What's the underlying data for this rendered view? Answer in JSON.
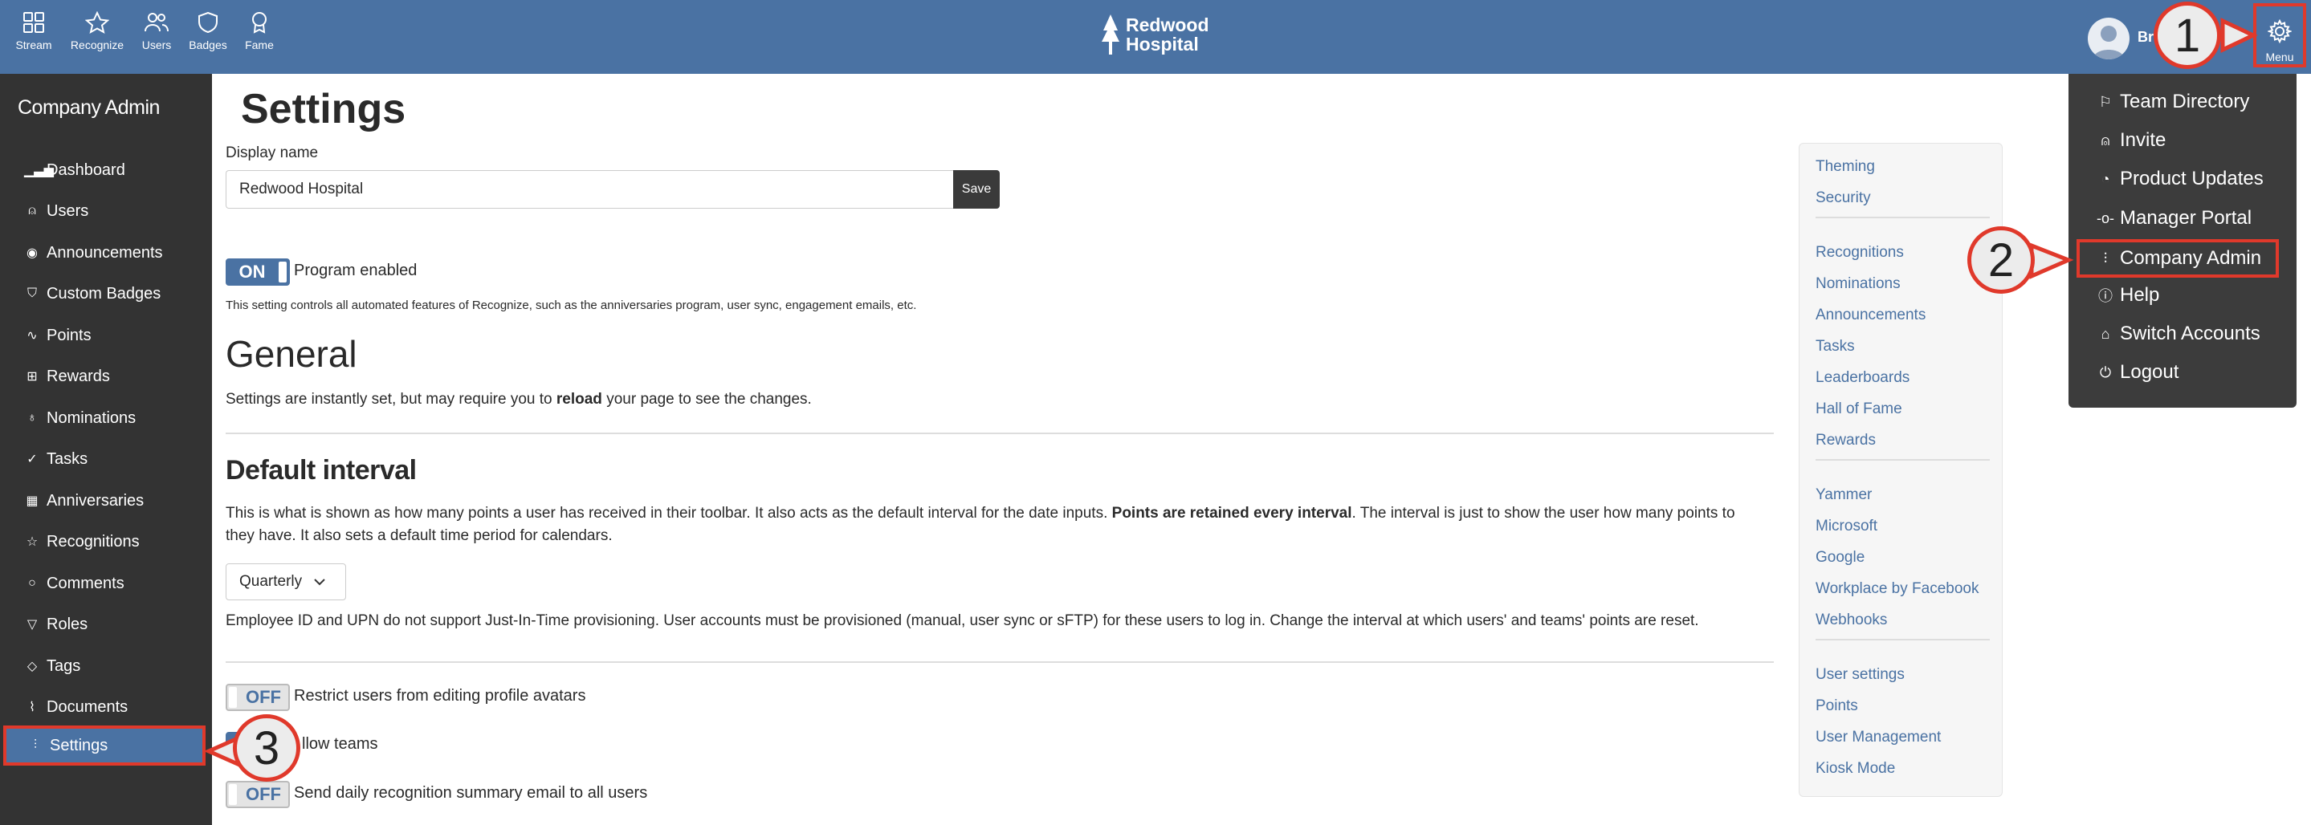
{
  "topnav": {
    "items": [
      {
        "label": "Stream",
        "icon": "grid-icon"
      },
      {
        "label": "Recognize",
        "icon": "star-icon"
      },
      {
        "label": "Users",
        "icon": "users-icon"
      },
      {
        "label": "Badges",
        "icon": "shield-icon"
      },
      {
        "label": "Fame",
        "icon": "award-icon"
      }
    ],
    "brand_line1": "Redwood",
    "brand_line2": "Hospital",
    "user_name_partial": "Br",
    "menu_label": "Menu"
  },
  "sidebar": {
    "title": "Company Admin",
    "items": [
      {
        "label": "Dashboard",
        "icon": "bar-chart-icon"
      },
      {
        "label": "Users",
        "icon": "user-icon"
      },
      {
        "label": "Announcements",
        "icon": "broadcast-icon"
      },
      {
        "label": "Custom Badges",
        "icon": "shield-icon"
      },
      {
        "label": "Points",
        "icon": "activity-icon"
      },
      {
        "label": "Rewards",
        "icon": "gift-icon"
      },
      {
        "label": "Nominations",
        "icon": "award-icon"
      },
      {
        "label": "Tasks",
        "icon": "check-circle-icon"
      },
      {
        "label": "Anniversaries",
        "icon": "calendar-icon"
      },
      {
        "label": "Recognitions",
        "icon": "star-icon"
      },
      {
        "label": "Comments",
        "icon": "comment-icon"
      },
      {
        "label": "Roles",
        "icon": "filter-icon"
      },
      {
        "label": "Tags",
        "icon": "tag-icon"
      },
      {
        "label": "Documents",
        "icon": "paperclip-icon"
      },
      {
        "label": "Settings",
        "icon": "sliders-icon",
        "active": true
      }
    ]
  },
  "main": {
    "title": "Settings",
    "display_name_label": "Display name",
    "display_name_value": "Redwood Hospital",
    "save_label": "Save",
    "program_toggle": "ON",
    "program_label": "Program enabled",
    "program_note": "This setting controls all automated features of Recognize, such as the anniversaries program, user sync, engagement emails, etc.",
    "general_heading": "General",
    "general_note_pre": "Settings are instantly set, but may require you to ",
    "general_note_bold": "reload",
    "general_note_post": " your page to see the changes.",
    "interval_heading": "Default interval",
    "interval_para_pre": "This is what is shown as how many points a user has received in their toolbar. It also acts as the default interval for the date inputs. ",
    "interval_para_bold": "Points are retained every interval",
    "interval_para_post1": ". The interval is just to show the user how many points to",
    "interval_para_post2": "they have. It also sets a default time period for calendars.",
    "interval_value": "Quarterly",
    "interval_note": "Employee ID and UPN do not support Just-In-Time provisioning. User accounts must be provisioned (manual, user sync or sFTP) for these users to log in. Change the interval at which users' and teams' points are reset.",
    "toggles": [
      {
        "state": "OFF",
        "label": "Restrict users from editing profile avatars"
      },
      {
        "state": "ON",
        "label": "Allow teams",
        "visible_label": "llow teams"
      },
      {
        "state": "OFF",
        "label": "Send daily recognition summary email to all users"
      }
    ]
  },
  "rightnav": {
    "groups": [
      [
        "Theming",
        "Security"
      ],
      [
        "Recognitions",
        "Nominations",
        "Announcements",
        "Tasks",
        "Leaderboards",
        "Hall of Fame",
        "Rewards"
      ],
      [
        "Yammer",
        "Microsoft",
        "Google",
        "Workplace by Facebook",
        "Webhooks"
      ],
      [
        "User settings",
        "Points",
        "User Management",
        "Kiosk Mode"
      ]
    ]
  },
  "dropdown": {
    "items": [
      {
        "label": "Team Directory",
        "icon": "flag-icon"
      },
      {
        "label": "Invite",
        "icon": "user-plus-icon"
      },
      {
        "label": "Product Updates",
        "icon": "bell-icon"
      },
      {
        "label": "Manager Portal",
        "icon": "git-commit-icon"
      },
      {
        "label": "Company Admin",
        "icon": "sliders-icon",
        "active": true
      },
      {
        "label": "Help",
        "icon": "help-circle-icon"
      },
      {
        "label": "Switch Accounts",
        "icon": "home-icon"
      },
      {
        "label": "Logout",
        "icon": "power-icon"
      }
    ]
  },
  "callouts": [
    "1",
    "2",
    "3"
  ],
  "colors": {
    "brand": "#4a72a3",
    "sidebar": "#333333",
    "highlight": "#e0392b",
    "link": "#4a72a3"
  }
}
